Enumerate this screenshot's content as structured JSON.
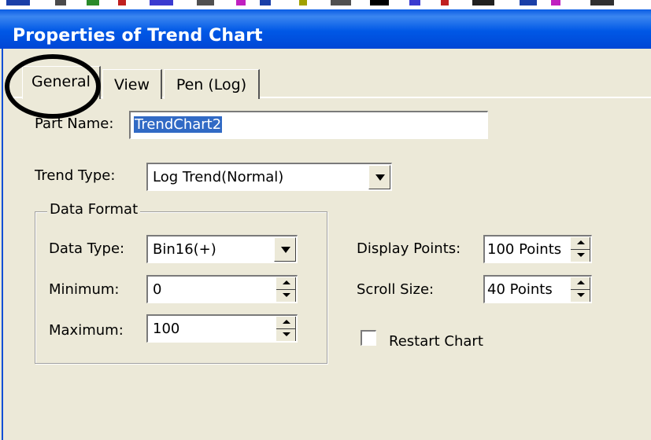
{
  "colors": {
    "titlebar": "#0058e6",
    "selection": "#316ac5",
    "dialog_bg": "#ece9d8"
  },
  "window": {
    "title": "Properties of Trend Chart"
  },
  "tabs": [
    {
      "label": "General",
      "active": true
    },
    {
      "label": "View",
      "active": false
    },
    {
      "label": "Pen (Log)",
      "active": false
    }
  ],
  "general": {
    "part_name_label": "Part Name:",
    "part_name_value": "TrendChart2",
    "trend_type_label": "Trend Type:",
    "trend_type_value": "Log Trend(Normal)",
    "data_format": {
      "group_label": "Data Format",
      "data_type_label": "Data Type:",
      "data_type_value": "Bin16(+)",
      "minimum_label": "Minimum:",
      "minimum_value": "0",
      "maximum_label": "Maximum:",
      "maximum_value": "100"
    },
    "display_points_label": "Display Points:",
    "display_points_value": "100 Points",
    "scroll_size_label": "Scroll Size:",
    "scroll_size_value": "40 Points",
    "restart_chart_label": "Restart Chart",
    "restart_chart_checked": false
  },
  "icons": [
    "dropdown-arrow-icon",
    "spin-up-icon",
    "spin-down-icon",
    "checkbox-icon"
  ]
}
